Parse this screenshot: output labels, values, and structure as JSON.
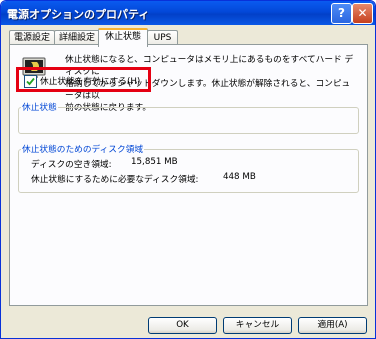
{
  "window": {
    "title": "電源オプションのプロパティ",
    "help_label": "?",
    "close_label": "✕"
  },
  "tabs": [
    {
      "label": "電源設定"
    },
    {
      "label": "詳細設定"
    },
    {
      "label": "休止状態"
    },
    {
      "label": "UPS"
    }
  ],
  "active_tab": "休止状態",
  "description_lines": [
    "休止状態になると、コンピュータはメモリ上にあるものをすべてハード ディスクに",
    "格納してからシャットダウンします。休止状態が解除されると、コンピュータは以",
    "前の状態に戻ります。"
  ],
  "hibernate_group": {
    "title": "休止状態",
    "checkbox_label": "休止状態を有効にする(H)",
    "checked": true
  },
  "disk_group": {
    "title": "休止状態のためのディスク領域",
    "free_space_label": "ディスクの空き領域:",
    "free_space_value": "15,851 MB",
    "required_label": "休止状態にするために必要なディスク領域:",
    "required_value": "448 MB"
  },
  "buttons": {
    "ok": "OK",
    "cancel": "キャンセル",
    "apply": "適用(A)"
  }
}
